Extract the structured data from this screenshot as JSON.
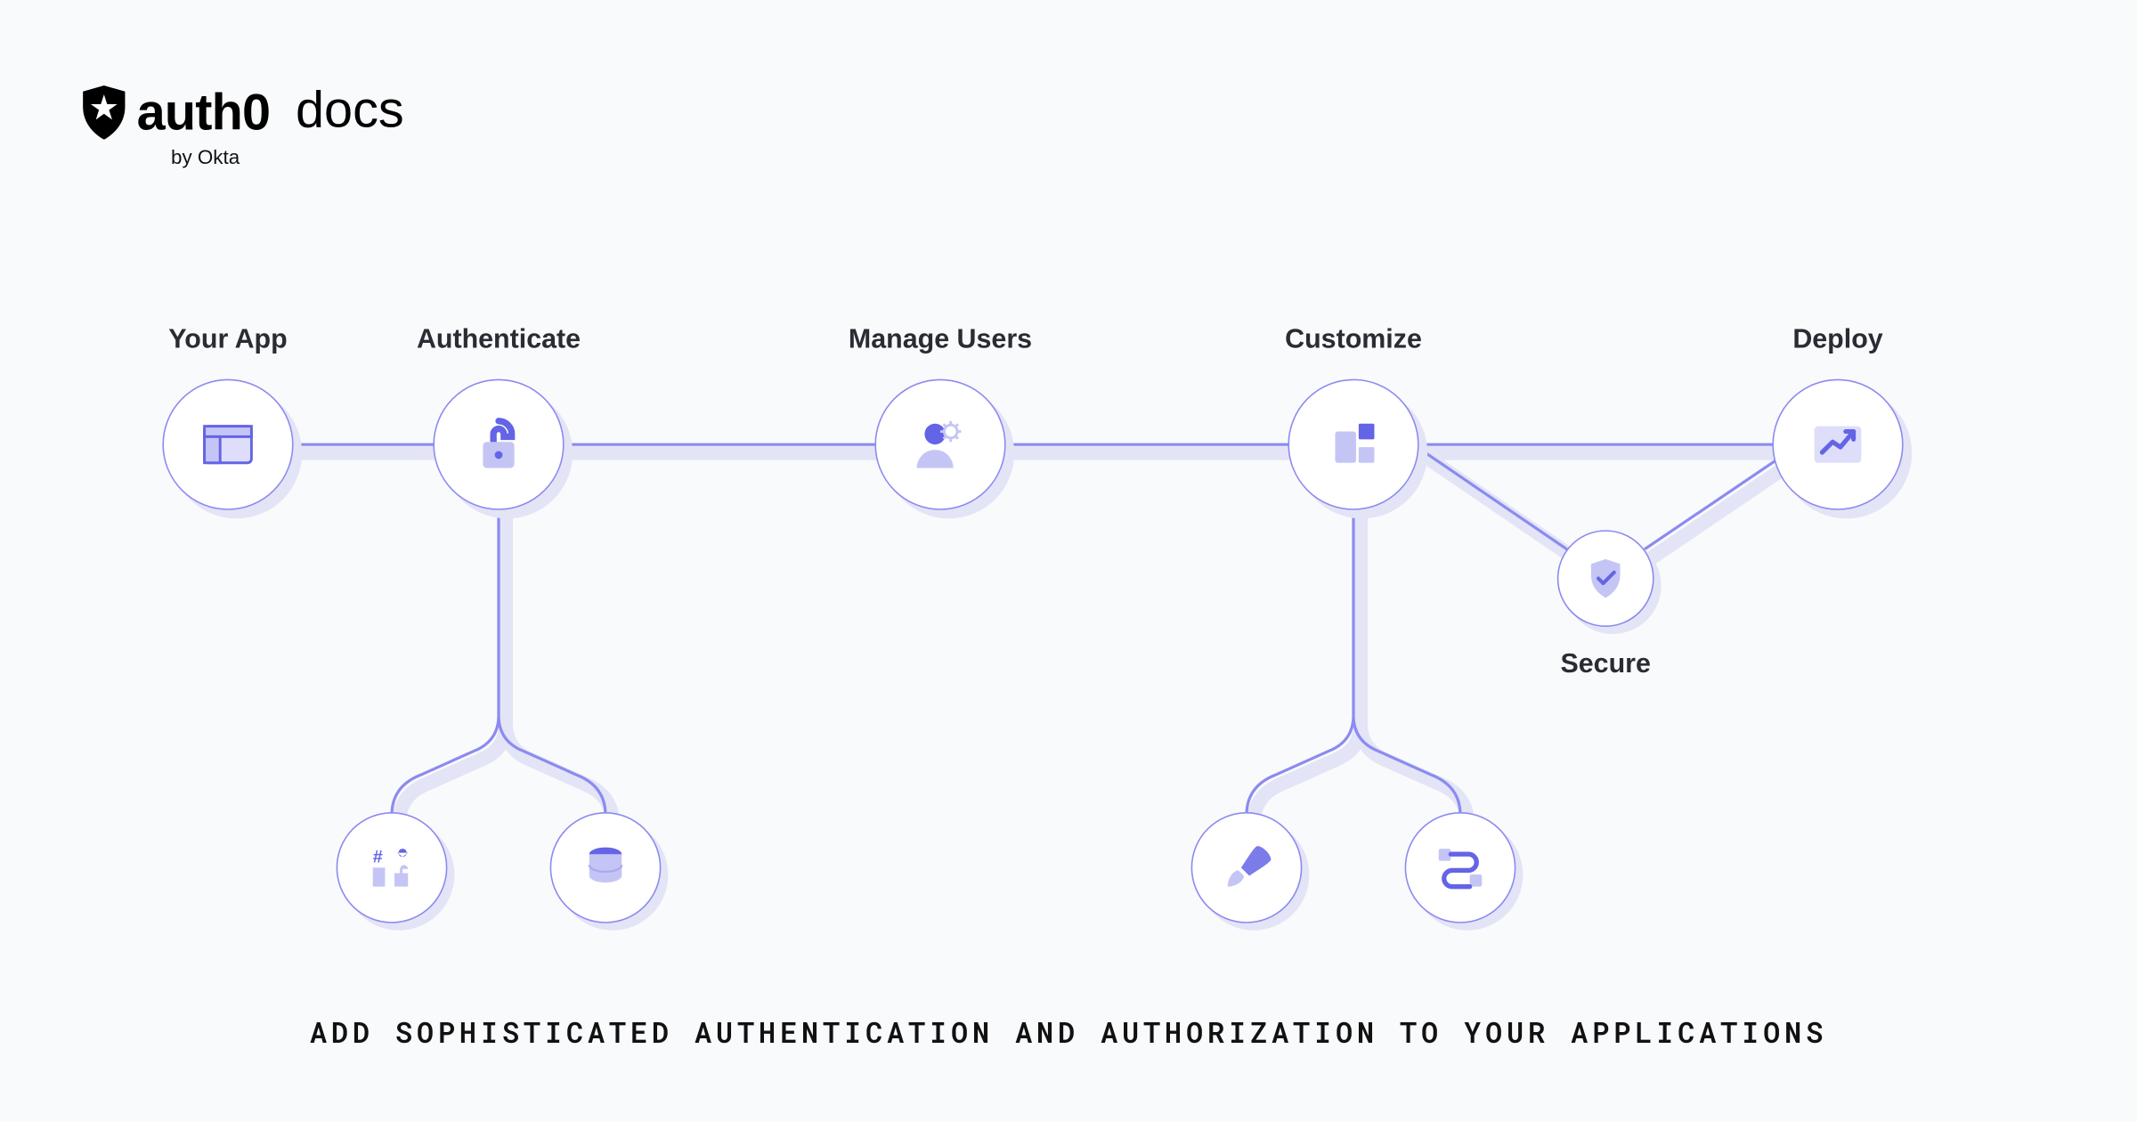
{
  "brand": {
    "name": "auth0",
    "byline": "by Okta",
    "section": "docs"
  },
  "nodes": {
    "yourApp": {
      "label": "Your App"
    },
    "authenticate": {
      "label": "Authenticate"
    },
    "manageUsers": {
      "label": "Manage Users"
    },
    "customize": {
      "label": "Customize"
    },
    "deploy": {
      "label": "Deploy"
    },
    "secure": {
      "label": "Secure"
    }
  },
  "tagline": "ADD SOPHISTICATED AUTHENTICATION AND AUTHORIZATION TO YOUR APPLICATIONS",
  "colors": {
    "accent": "#6464e6",
    "accentLight": "#c5c5f5",
    "stroke": "#8b8bf0",
    "shadow": "#e4e4f7"
  }
}
